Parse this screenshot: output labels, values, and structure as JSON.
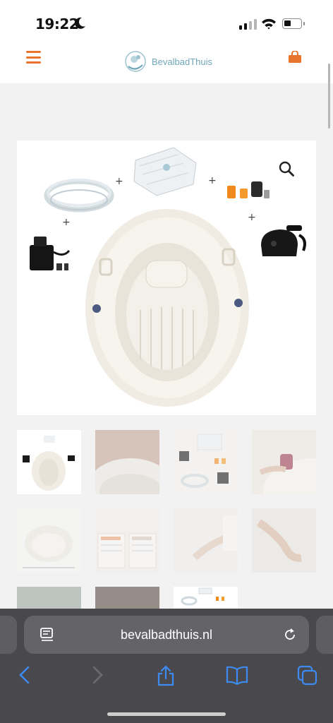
{
  "status_bar": {
    "time": "19:22",
    "moon_icon": "moon-icon",
    "signal_icon": "cellular-signal-icon",
    "wifi_icon": "wifi-icon",
    "battery_icon": "battery-icon",
    "battery_level": 0.3
  },
  "header": {
    "menu_icon": "hamburger-menu-icon",
    "logo_text": "BevalbadThuis",
    "cart_icon": "shopping-bag-icon"
  },
  "product": {
    "zoom_icon": "magnifier-icon",
    "plus_sign": "+",
    "components": [
      "water-hose",
      "pool-liner",
      "hose-connectors",
      "water-pump",
      "air-pump",
      "inflatable-birth-pool"
    ]
  },
  "gallery": {
    "thumbnails": [
      "thumb-product-set",
      "thumb-pool-edge",
      "thumb-accessories",
      "thumb-hand-cup",
      "thumb-dimensions",
      "thumb-infographic",
      "thumb-hand-pool",
      "thumb-arm-pool",
      "thumb-window-room",
      "thumb-dark-room",
      "thumb-product-set-2"
    ],
    "selected_index": 0
  },
  "browser": {
    "url": "bevalbadthuis.nl",
    "reader_icon": "reader-mode-icon",
    "reload_icon": "reload-icon",
    "toolbar": [
      "back-icon",
      "forward-icon",
      "share-icon",
      "bookmarks-icon",
      "tabs-icon"
    ]
  },
  "colors": {
    "accent": "#e8742e",
    "logo": "#6fa7b8",
    "toolbar_blue": "#3d8bf2",
    "browser_bg": "#49494d"
  }
}
